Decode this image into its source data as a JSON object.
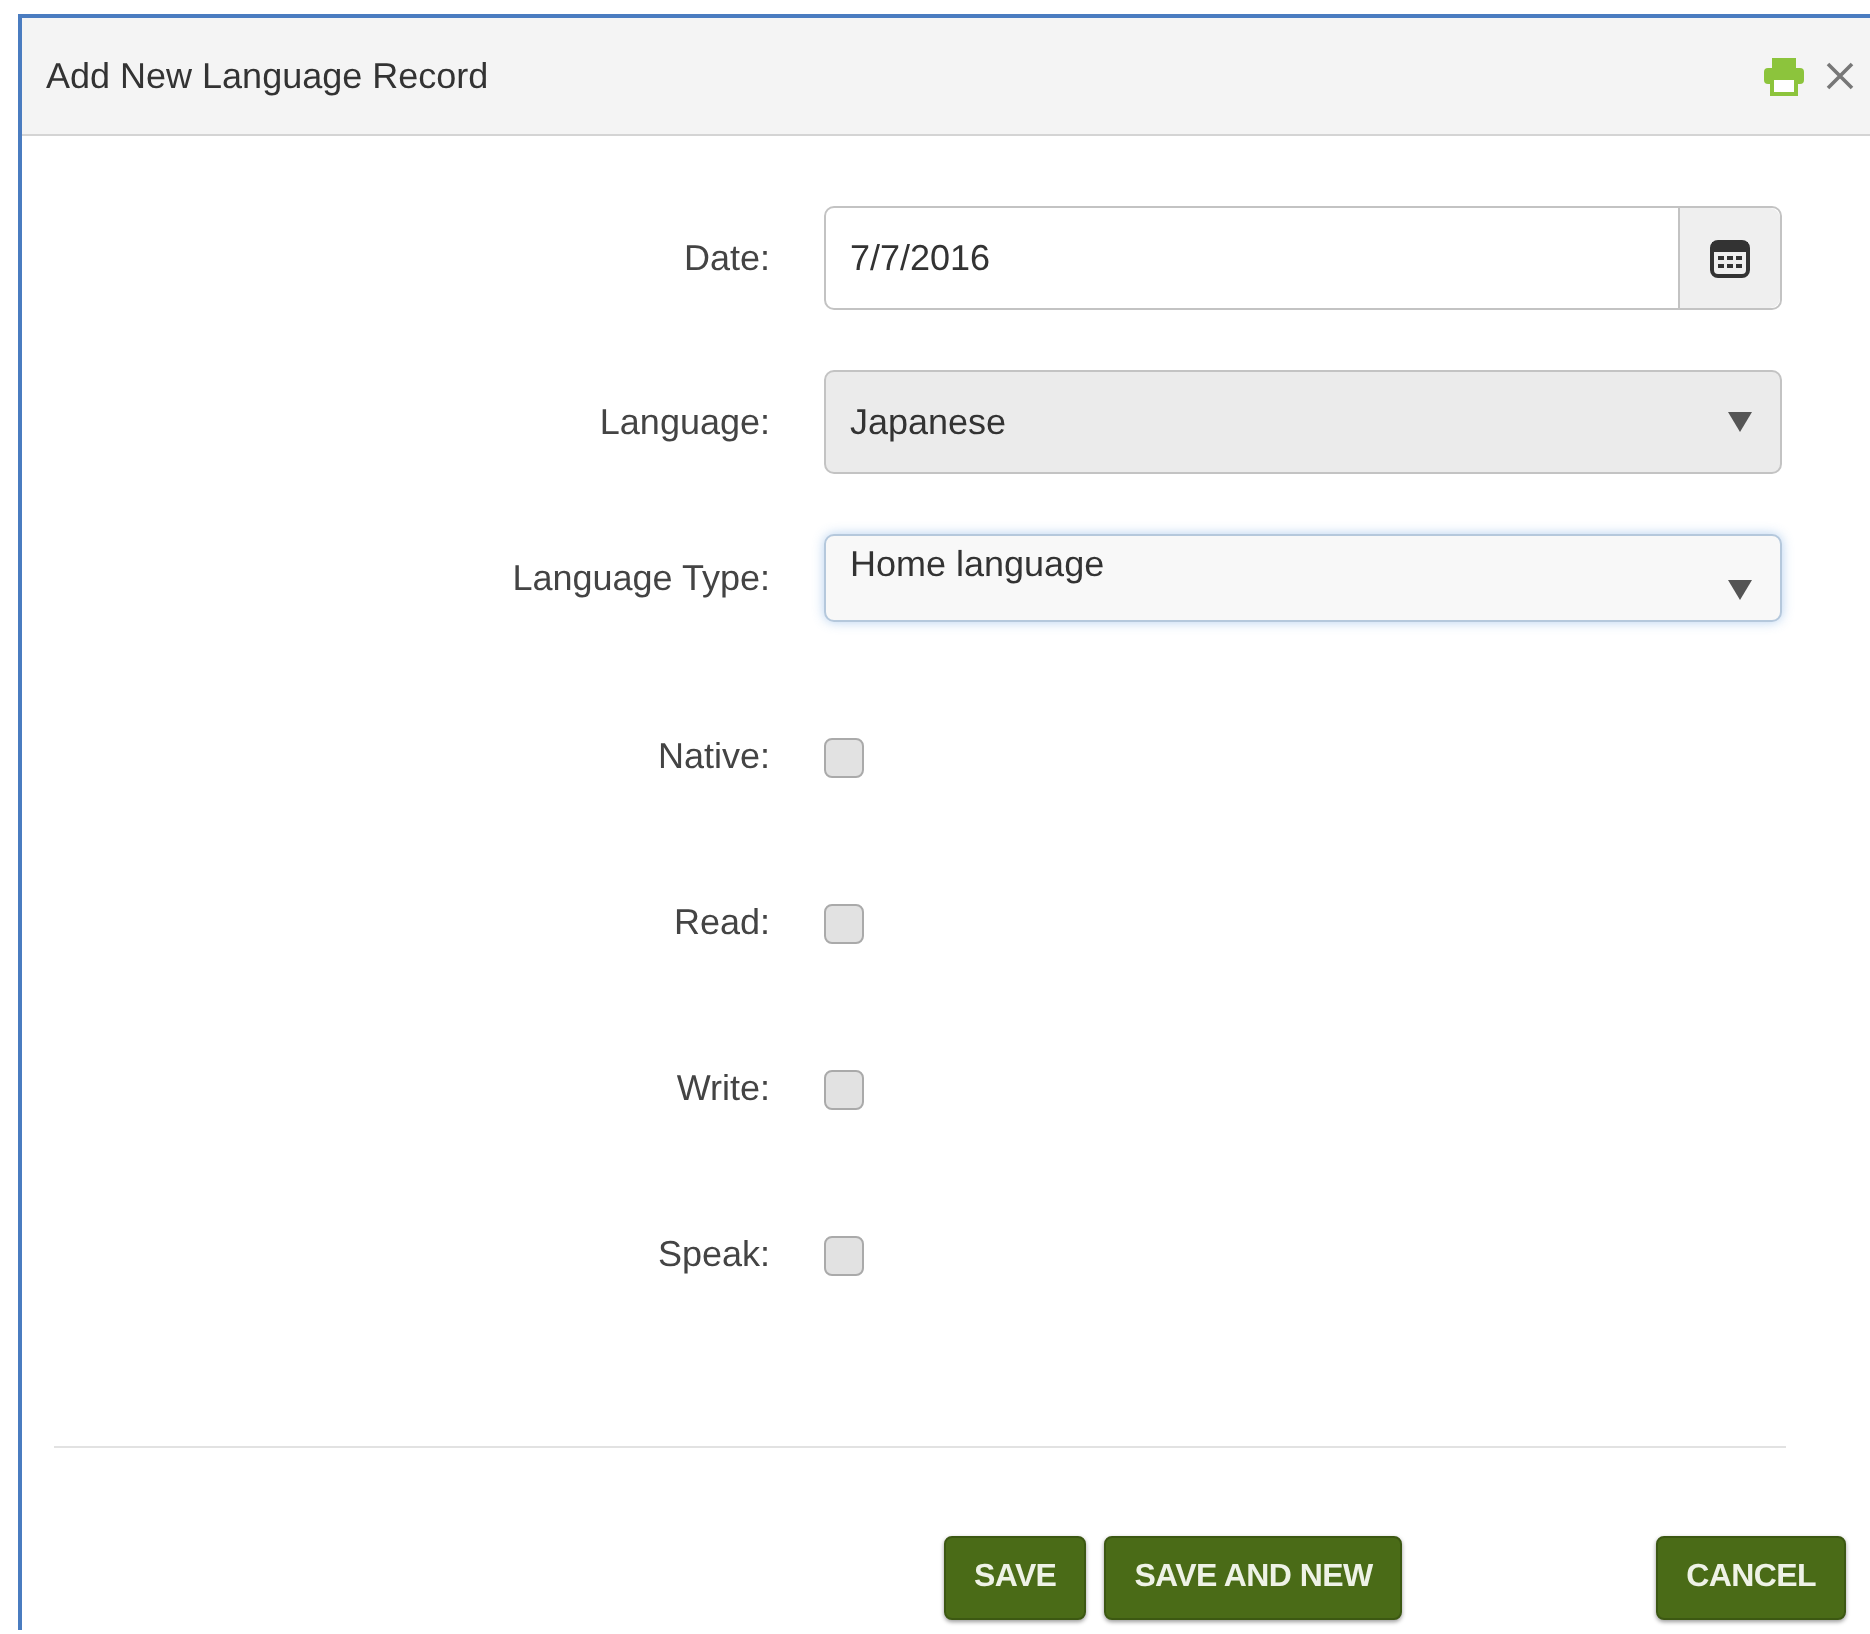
{
  "window": {
    "title": "Add New Language Record"
  },
  "fields": [
    {
      "kind": "date",
      "label": "Date:",
      "value": "7/7/2016"
    },
    {
      "kind": "dropdown",
      "label": "Language:",
      "value": "Japanese",
      "disabled": true,
      "focused": false
    },
    {
      "kind": "dropdown",
      "label": "Language Type:",
      "value": "Home language",
      "disabled": false,
      "focused": true
    },
    {
      "kind": "checkbox",
      "label": "Native:",
      "checked": false
    },
    {
      "kind": "checkbox",
      "label": "Read:",
      "checked": false
    },
    {
      "kind": "checkbox",
      "label": "Write:",
      "checked": false
    },
    {
      "kind": "checkbox",
      "label": "Speak:",
      "checked": false
    }
  ],
  "buttons": [
    "SAVE",
    "SAVE AND NEW",
    "CANCEL"
  ]
}
